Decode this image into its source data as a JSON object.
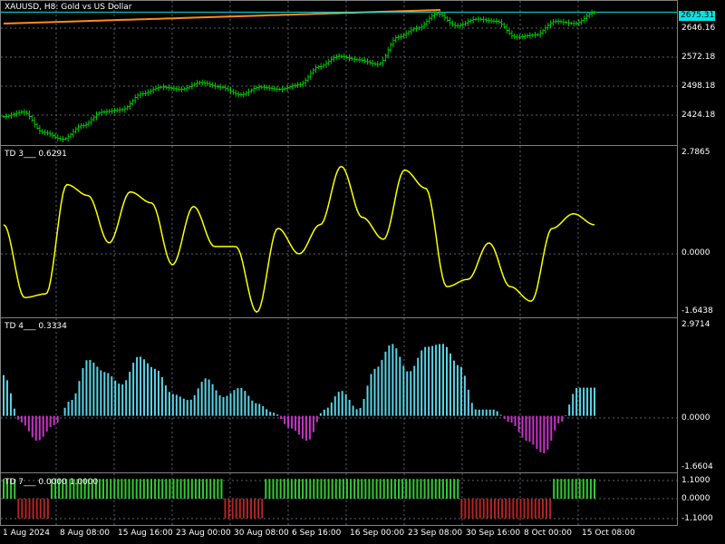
{
  "header": {
    "title": "XAUUSD, H8:  Gold vs US Dollar",
    "td3_label": "TD 3___ 0.6291",
    "td4_label": "TD 4___ 0.3334",
    "td7_label": "TD 7___ 0.0000 1.0000"
  },
  "price_axis": {
    "current": "2675.31",
    "ticks": [
      "2646.16",
      "2572.18",
      "2498.18",
      "2424.18"
    ]
  },
  "td3_axis": {
    "ticks": [
      "2.7865",
      "0.0000",
      "-1.6438"
    ]
  },
  "td4_axis": {
    "ticks": [
      "2.9714",
      "0.0000",
      "-1.6604"
    ]
  },
  "td7_axis": {
    "ticks": [
      "1.1000",
      "0.0000",
      "-1.1000"
    ]
  },
  "time_axis": {
    "ticks": [
      "1 Aug 2024",
      "8 Aug 08:00",
      "15 Aug 16:00",
      "23 Aug 00:00",
      "30 Aug 08:00",
      "6 Sep 16:00",
      "16 Sep 00:00",
      "23 Sep 08:00",
      "30 Sep 16:00",
      "8 Oct 00:00",
      "15 Oct 08:00"
    ]
  },
  "colors": {
    "background": "#000000",
    "grid": "#5a6472",
    "candles": "#00c800",
    "ma": "#ff8c1a",
    "price_line": "#00e5e5",
    "td3_line": "#ffff00",
    "hist_pos": "#5ad2e6",
    "hist_neg": "#c832c8",
    "td7_pos": "#32c832",
    "td7_neg": "#b42323"
  },
  "chart_data": [
    {
      "type": "line",
      "symbol": "XAUUSD",
      "timeframe": "H8",
      "x_range": [
        "1 Aug 2024",
        "17 Oct 2024"
      ],
      "ylim": [
        2390,
        2690
      ],
      "close_keypoints": [
        {
          "x": "1 Aug",
          "y": 2445
        },
        {
          "x": "2 Aug",
          "y": 2455
        },
        {
          "x": "5 Aug",
          "y": 2410
        },
        {
          "x": "6 Aug",
          "y": 2395
        },
        {
          "x": "8 Aug",
          "y": 2425
        },
        {
          "x": "12 Aug",
          "y": 2455
        },
        {
          "x": "15 Aug",
          "y": 2460
        },
        {
          "x": "19 Aug",
          "y": 2495
        },
        {
          "x": "21 Aug",
          "y": 2510
        },
        {
          "x": "23 Aug",
          "y": 2505
        },
        {
          "x": "27 Aug",
          "y": 2520
        },
        {
          "x": "29 Aug",
          "y": 2510
        },
        {
          "x": "3 Sep",
          "y": 2493
        },
        {
          "x": "5 Sep",
          "y": 2510
        },
        {
          "x": "9 Sep",
          "y": 2505
        },
        {
          "x": "11 Sep",
          "y": 2515
        },
        {
          "x": "12 Sep",
          "y": 2555
        },
        {
          "x": "13 Sep",
          "y": 2578
        },
        {
          "x": "17 Sep",
          "y": 2570
        },
        {
          "x": "18 Sep",
          "y": 2560
        },
        {
          "x": "20 Sep",
          "y": 2620
        },
        {
          "x": "23 Sep",
          "y": 2640
        },
        {
          "x": "26 Sep",
          "y": 2672
        },
        {
          "x": "30 Sep",
          "y": 2645
        },
        {
          "x": "2 Oct",
          "y": 2660
        },
        {
          "x": "4 Oct",
          "y": 2655
        },
        {
          "x": "8 Oct",
          "y": 2620
        },
        {
          "x": "10 Oct",
          "y": 2625
        },
        {
          "x": "11 Oct",
          "y": 2655
        },
        {
          "x": "14 Oct",
          "y": 2650
        },
        {
          "x": "16 Oct",
          "y": 2675
        }
      ],
      "ma_range": [
        2650,
        2680
      ],
      "current_price": 2675.31
    },
    {
      "type": "line",
      "name": "TD 3",
      "last_value": 0.6291,
      "ylim": [
        -1.6438,
        2.7865
      ],
      "keypoints": [
        0.8,
        -1.2,
        -1.1,
        1.9,
        1.6,
        0.3,
        1.7,
        1.4,
        -0.3,
        1.3,
        0.2,
        0.2,
        -1.6,
        0.7,
        0,
        0.8,
        2.4,
        1.0,
        0.4,
        2.3,
        1.8,
        -0.9,
        -0.7,
        0.3,
        -0.9,
        -1.3,
        0.7,
        1.1,
        0.8
      ]
    },
    {
      "type": "bar",
      "name": "TD 4",
      "last_value": 0.3334,
      "ylim": [
        -1.6604,
        2.9714
      ],
      "keypoints": [
        1.3,
        -0.2,
        -0.8,
        -0.3,
        0.5,
        1.8,
        1.4,
        1.0,
        1.9,
        1.5,
        0.7,
        0.5,
        1.2,
        0.6,
        0.9,
        0.4,
        0.1,
        -0.4,
        -0.8,
        0.2,
        0.8,
        0.2,
        1.5,
        2.3,
        1.4,
        2.2,
        2.3,
        1.6,
        0.2,
        0.2,
        -0.2,
        -0.8,
        -1.2,
        -0.2,
        0.9,
        0.9
      ]
    },
    {
      "type": "bar",
      "name": "TD 7",
      "values_label": "0.0000 1.0000",
      "ylim": [
        -1.1,
        1.1
      ],
      "segments": [
        {
          "value": 1.0,
          "count": 4
        },
        {
          "value": -1.0,
          "count": 9
        },
        {
          "value": 1.0,
          "count": 47
        },
        {
          "value": -1.0,
          "count": 11
        },
        {
          "value": 1.0,
          "count": 53
        },
        {
          "value": -1.0,
          "count": 25
        },
        {
          "value": 1.0,
          "count": 12
        }
      ]
    }
  ]
}
